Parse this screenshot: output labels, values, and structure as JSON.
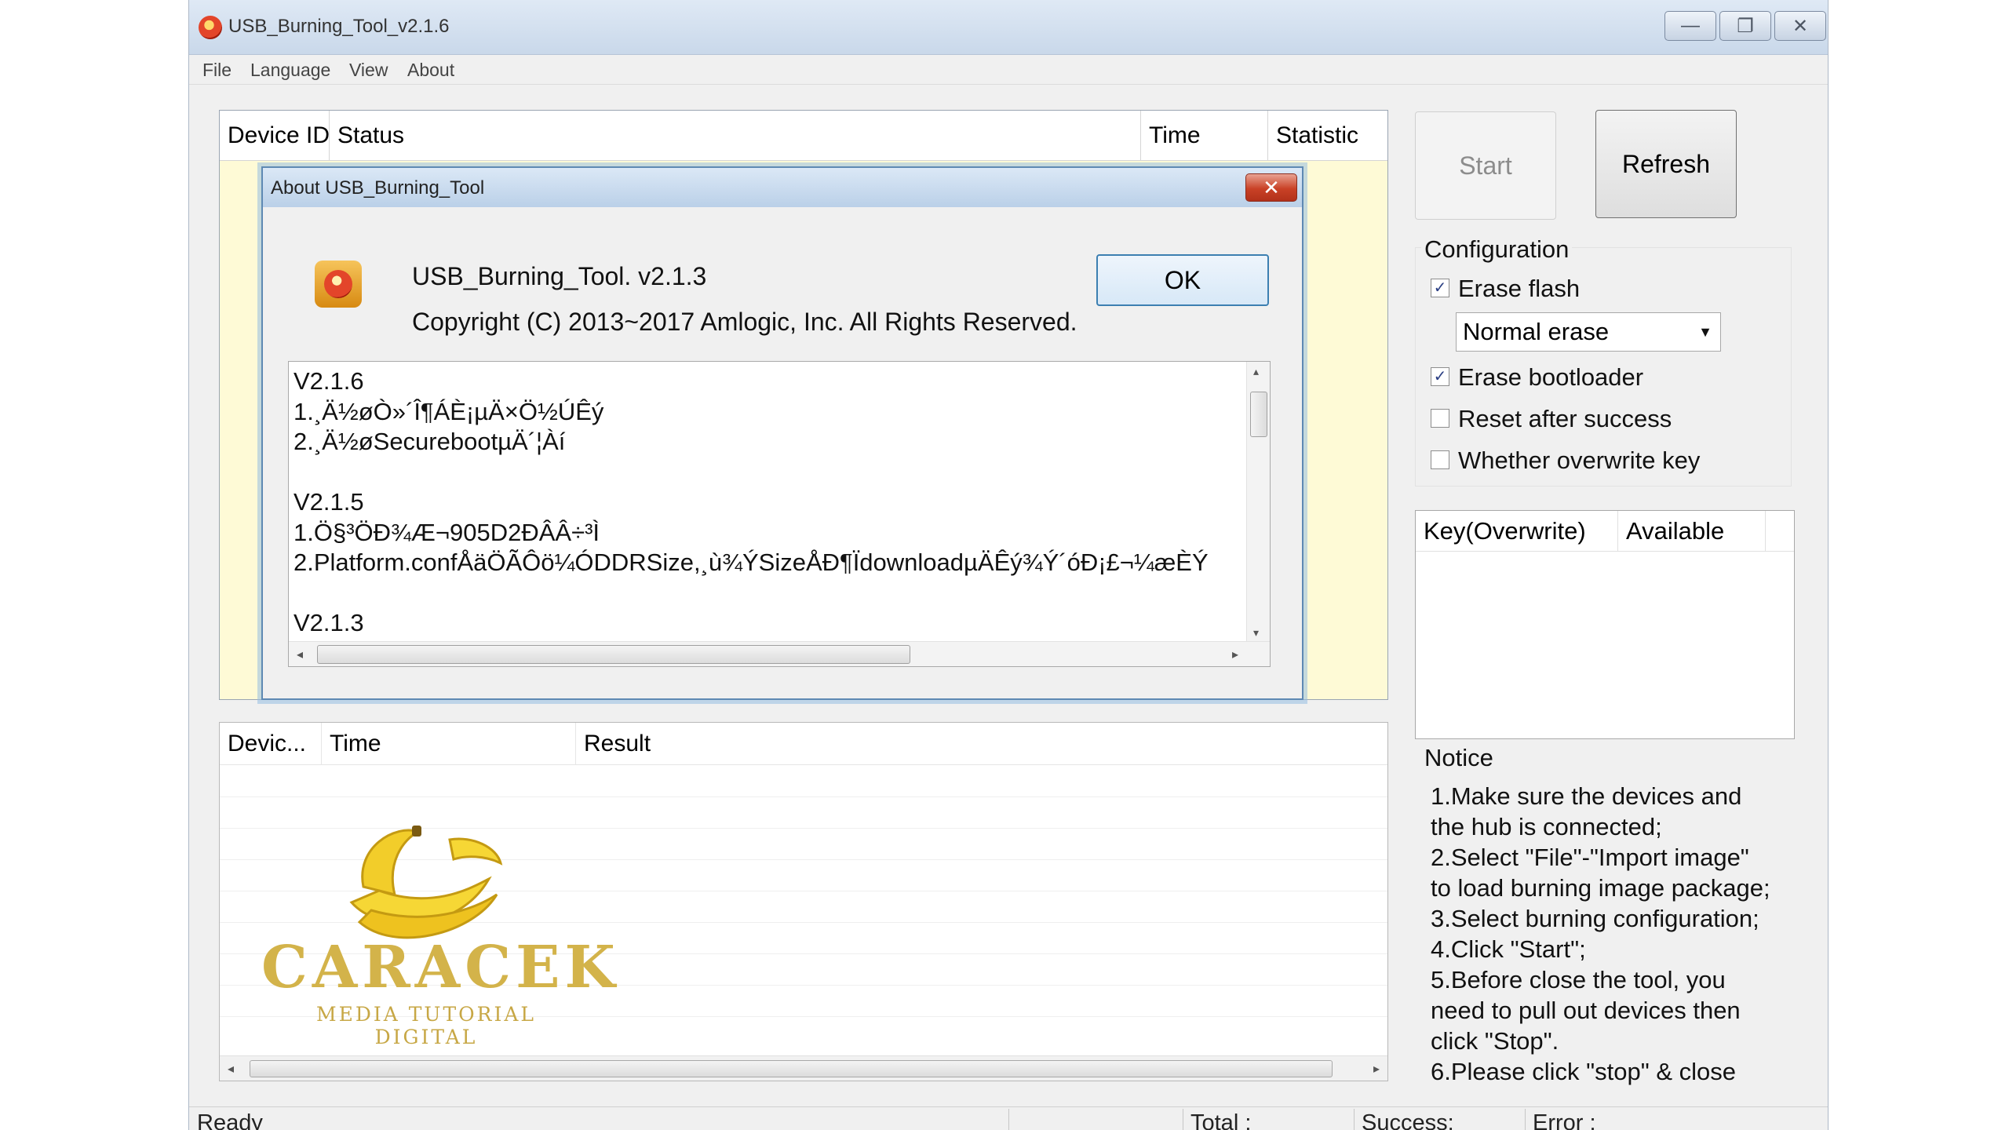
{
  "window": {
    "title": "USB_Burning_Tool_v2.1.6",
    "minimize_glyph": "—",
    "maximize_glyph": "❐",
    "close_glyph": "✕"
  },
  "menu": [
    "File",
    "Language",
    "View",
    "About"
  ],
  "device_list": {
    "columns": [
      "Device ID",
      "Status",
      "Time",
      "Statistic"
    ]
  },
  "buttons": {
    "start": "Start",
    "refresh": "Refresh"
  },
  "configuration": {
    "label": "Configuration",
    "erase_flash": {
      "label": "Erase flash",
      "checked": true
    },
    "erase_mode": "Normal erase",
    "erase_bootloader": {
      "label": "Erase bootloader",
      "checked": true
    },
    "reset_after_success": {
      "label": "Reset after success",
      "checked": false
    },
    "overwrite_key": {
      "label": "Whether overwrite key",
      "checked": false
    },
    "check_glyph": "✓"
  },
  "key_table": {
    "columns": [
      "Key(Overwrite)",
      "Available"
    ]
  },
  "notice": {
    "label": "Notice",
    "lines": [
      "1.Make sure the devices and",
      "the hub is connected;",
      "2.Select \"File\"-\"Import image\"",
      "to load burning image package;",
      "3.Select burning configuration;",
      "4.Click \"Start\";",
      "5.Before close the tool, you",
      "need to pull out devices then",
      "click \"Stop\".",
      "6.Please click \"stop\" & close"
    ]
  },
  "result_list": {
    "columns": [
      "Devic...",
      "Time",
      "Result"
    ]
  },
  "status_bar": {
    "state": "Ready",
    "total": "Total :",
    "success": "Success:",
    "error": "Error :"
  },
  "watermark": {
    "title": "CARACEK",
    "subtitle": "MEDIA TUTORIAL DIGITAL"
  },
  "about_dialog": {
    "title": "About USB_Burning_Tool",
    "close_glyph": "✕",
    "product": "USB_Burning_Tool. v2.1.3",
    "copyright": "Copyright (C) 2013~2017 Amlogic, Inc. All Rights Reserved.",
    "ok": "OK",
    "changelog": [
      "V2.1.6",
      "1.¸Ä½øÒ»´Î¶ÁÈ¡µÄ×Ö½ÚÊý",
      "2.¸Ä½øSecurebootµÄ´¦Àí",
      "",
      "V2.1.5",
      "1.Ö§³ÖÐ¾Æ¬905D2ÐÂÂ÷³Ì",
      "2.Platform.confÅäÖÃÔö¼ÓDDRSize,¸ù¾ÝSizeÅÐ¶ÏdownloadµÄÊý¾Ý´óÐ¡£¬¼æÈÝ",
      "",
      "V2.1.3"
    ]
  }
}
